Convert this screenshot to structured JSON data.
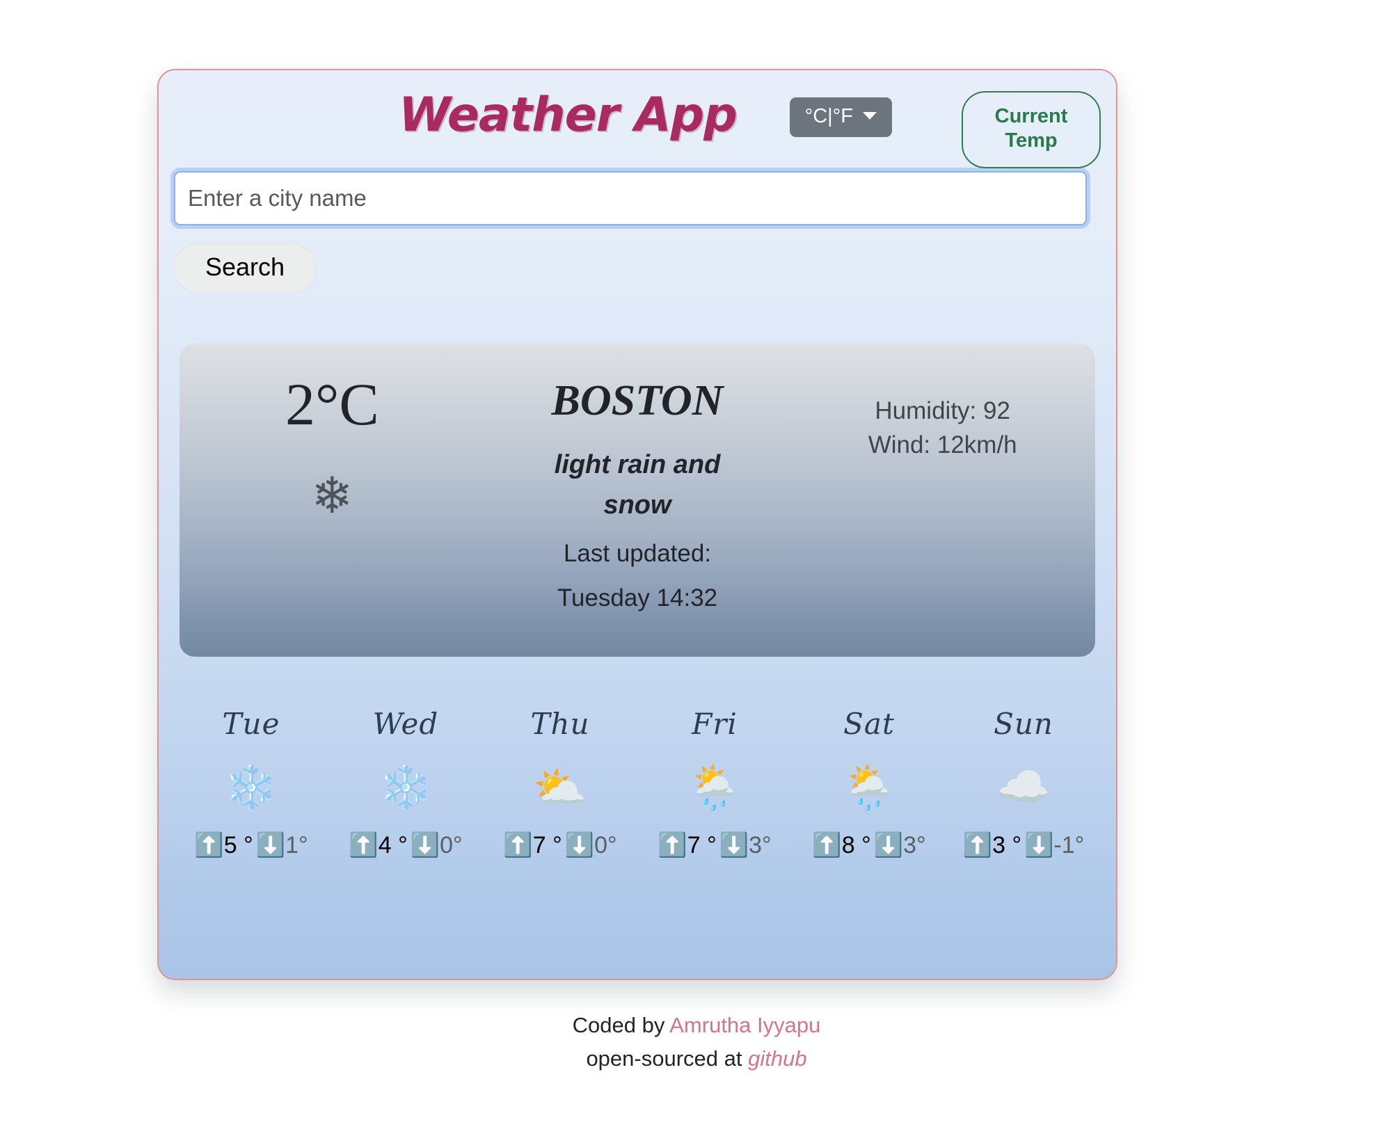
{
  "header": {
    "title": "Weather App",
    "unit_toggle_label": "°C|°F",
    "unit_caret_icon": "chevron-down-icon",
    "current_temp_label": "Current\nTemp"
  },
  "search": {
    "placeholder": "Enter a city name",
    "value": "",
    "button_label": "Search"
  },
  "current": {
    "temperature": "2°C",
    "icon": "❄",
    "icon_name": "snowflake-icon",
    "city": "BOSTON",
    "condition": "light rain and snow",
    "updated_label": "Last updated:",
    "updated_value": "Tuesday 14:32",
    "humidity": "Humidity: 92",
    "wind": "Wind: 12km/h"
  },
  "forecast": [
    {
      "day": "Tue",
      "icon": "❄️",
      "icon_name": "snowflake-icon",
      "max": "5 °",
      "min": "1°"
    },
    {
      "day": "Wed",
      "icon": "❄️",
      "icon_name": "snowflake-icon",
      "max": "4 °",
      "min": "0°"
    },
    {
      "day": "Thu",
      "icon": "⛅",
      "icon_name": "sun-behind-cloud-icon",
      "max": "7 °",
      "min": "0°"
    },
    {
      "day": "Fri",
      "icon": "🌦️",
      "icon_name": "sun-behind-rain-cloud-icon",
      "max": "7 °",
      "min": "3°"
    },
    {
      "day": "Sat",
      "icon": "🌦️",
      "icon_name": "sun-behind-rain-cloud-icon",
      "max": "8 °",
      "min": "3°"
    },
    {
      "day": "Sun",
      "icon": "☁️",
      "icon_name": "cloud-icon",
      "max": "3 °",
      "min": "-1°"
    }
  ],
  "forecast_icons": {
    "up_arrow": "⬆️",
    "down_arrow": "⬇️"
  },
  "footer": {
    "coded_by_prefix": "Coded by ",
    "author": "Amrutha Iyyapu",
    "open_sourced_prefix": "open-sourced at ",
    "repo_link": "github"
  },
  "colors": {
    "brand_title": "#a92a5e",
    "container_border": "#dc9693",
    "accent_green": "#2a7a4b",
    "unit_button_bg": "#6c757d",
    "footer_accent": "#d6748f"
  }
}
